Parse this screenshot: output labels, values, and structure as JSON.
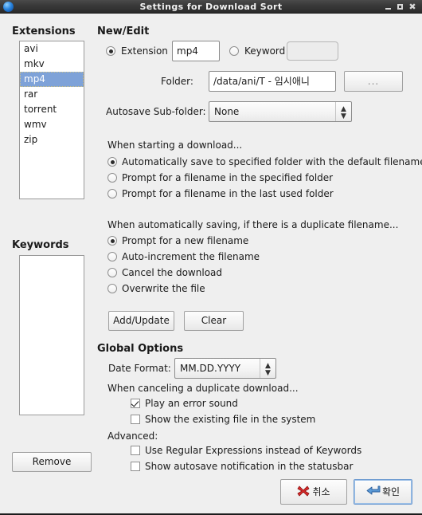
{
  "window": {
    "title": "Settings for Download Sort",
    "icon": "globe-icon",
    "controls": {
      "minimize": "minimize-icon",
      "maximize": "maximize-icon",
      "close": "close-icon"
    }
  },
  "extensions_group": {
    "heading": "Extensions",
    "items": [
      "avi",
      "mkv",
      "mp4",
      "rar",
      "torrent",
      "wmv",
      "zip"
    ],
    "selected": "mp4"
  },
  "keywords_group": {
    "heading": "Keywords",
    "items": [],
    "remove_label": "Remove"
  },
  "new_edit": {
    "heading": "New/Edit",
    "extension_radio_label": "Extension",
    "extension_value": "mp4",
    "extension_selected": true,
    "keyword_radio_label": "Keyword",
    "keyword_value": "",
    "keyword_selected": false,
    "folder_label": "Folder:",
    "folder_value": "/data/ani/T - 임시애니",
    "browse_label": "...",
    "autosave_label": "Autosave Sub-folder:",
    "autosave_value": "None"
  },
  "start_download": {
    "heading": "When starting a download...",
    "options": [
      {
        "label": "Automatically save to specified folder with the default filename",
        "selected": true
      },
      {
        "label": "Prompt for a filename in the specified folder",
        "selected": false
      },
      {
        "label": "Prompt for a filename in the last used folder",
        "selected": false
      }
    ]
  },
  "duplicate_filename": {
    "heading": "When automatically saving, if there is a duplicate filename...",
    "options": [
      {
        "label": "Prompt for a new filename",
        "selected": true
      },
      {
        "label": "Auto-increment the filename",
        "selected": false
      },
      {
        "label": "Cancel the download",
        "selected": false
      },
      {
        "label": "Overwrite the file",
        "selected": false
      }
    ]
  },
  "actions": {
    "add_update_label": "Add/Update",
    "clear_label": "Clear"
  },
  "global_options": {
    "heading": "Global Options",
    "date_format_label": "Date Format:",
    "date_format_value": "MM.DD.YYYY",
    "cancel_heading": "When canceling a duplicate download...",
    "cancel_checks": [
      {
        "label": "Play an error sound",
        "checked": true
      },
      {
        "label": "Show the existing file in the system",
        "checked": false
      }
    ],
    "advanced_heading": "Advanced:",
    "advanced_checks": [
      {
        "label": "Use Regular Expressions instead of Keywords",
        "checked": false
      },
      {
        "label": "Show autosave notification in the statusbar",
        "checked": false
      }
    ]
  },
  "footer": {
    "cancel_label": "취소",
    "cancel_icon": "red-x-icon",
    "ok_label": "확인",
    "ok_icon": "blue-enter-arrow-icon"
  },
  "colors": {
    "selection": "#7ea2d8",
    "window_bg": "#efefef",
    "titlebar": "#3a3a3a",
    "cancel_icon": "#d92b2b",
    "ok_icon": "#3f7fc8",
    "focus_border": "#6d9ad0"
  }
}
